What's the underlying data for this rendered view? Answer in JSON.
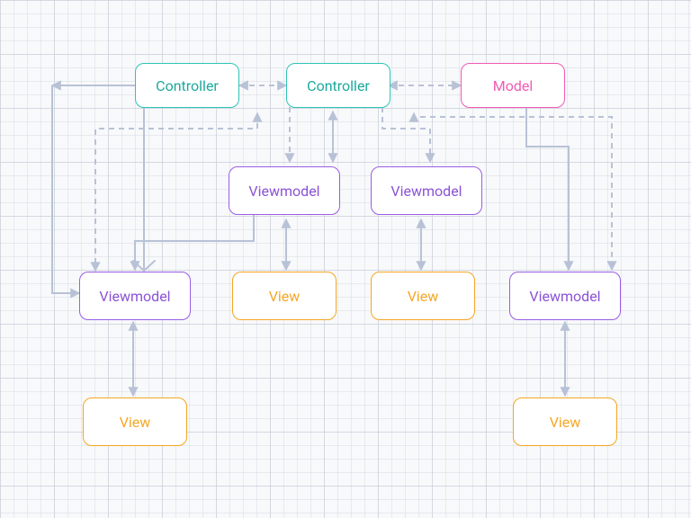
{
  "diagram": {
    "type": "architecture-diagram",
    "nodes": {
      "controller1": {
        "label": "Controller",
        "role": "controller"
      },
      "controller2": {
        "label": "Controller",
        "role": "controller"
      },
      "model1": {
        "label": "Model",
        "role": "model"
      },
      "viewmodel1": {
        "label": "Viewmodel",
        "role": "viewmodel"
      },
      "viewmodel2": {
        "label": "Viewmodel",
        "role": "viewmodel"
      },
      "viewmodel3": {
        "label": "Viewmodel",
        "role": "viewmodel"
      },
      "viewmodel4": {
        "label": "Viewmodel",
        "role": "viewmodel"
      },
      "view1": {
        "label": "View",
        "role": "view"
      },
      "view2": {
        "label": "View",
        "role": "view"
      },
      "view3": {
        "label": "View",
        "role": "view"
      },
      "view4": {
        "label": "View",
        "role": "view"
      }
    },
    "edges": [
      {
        "from": "controller1",
        "to": "controller2",
        "style": "dashed-bi"
      },
      {
        "from": "controller2",
        "to": "model1",
        "style": "dashed-bi"
      },
      {
        "from": "controller1",
        "to": "viewmodel3",
        "style": "solid"
      },
      {
        "from": "controller2",
        "to": "viewmodel1",
        "style": "dashed"
      },
      {
        "from": "controller2",
        "to": "viewmodel2",
        "style": "dashed"
      },
      {
        "from": "controller2",
        "to": "viewmodel3",
        "style": "dashed"
      },
      {
        "from": "controller2",
        "to": "viewmodel4",
        "style": "dashed"
      },
      {
        "from": "model1",
        "to": "viewmodel4",
        "style": "solid"
      },
      {
        "from": "viewmodel1",
        "to": "viewmodel3",
        "style": "solid"
      },
      {
        "from": "viewmodel1",
        "to": "view2",
        "style": "solid-bi"
      },
      {
        "from": "viewmodel2",
        "to": "view3",
        "style": "solid-bi"
      },
      {
        "from": "viewmodel3",
        "to": "view1",
        "style": "solid-bi"
      },
      {
        "from": "viewmodel4",
        "to": "view4",
        "style": "solid-bi"
      }
    ],
    "colors": {
      "controller": "#2ec4b6",
      "model": "#f15bb5",
      "viewmodel": "#9b5de5",
      "view": "#f5a623",
      "connector": "#b8c2d6"
    }
  }
}
